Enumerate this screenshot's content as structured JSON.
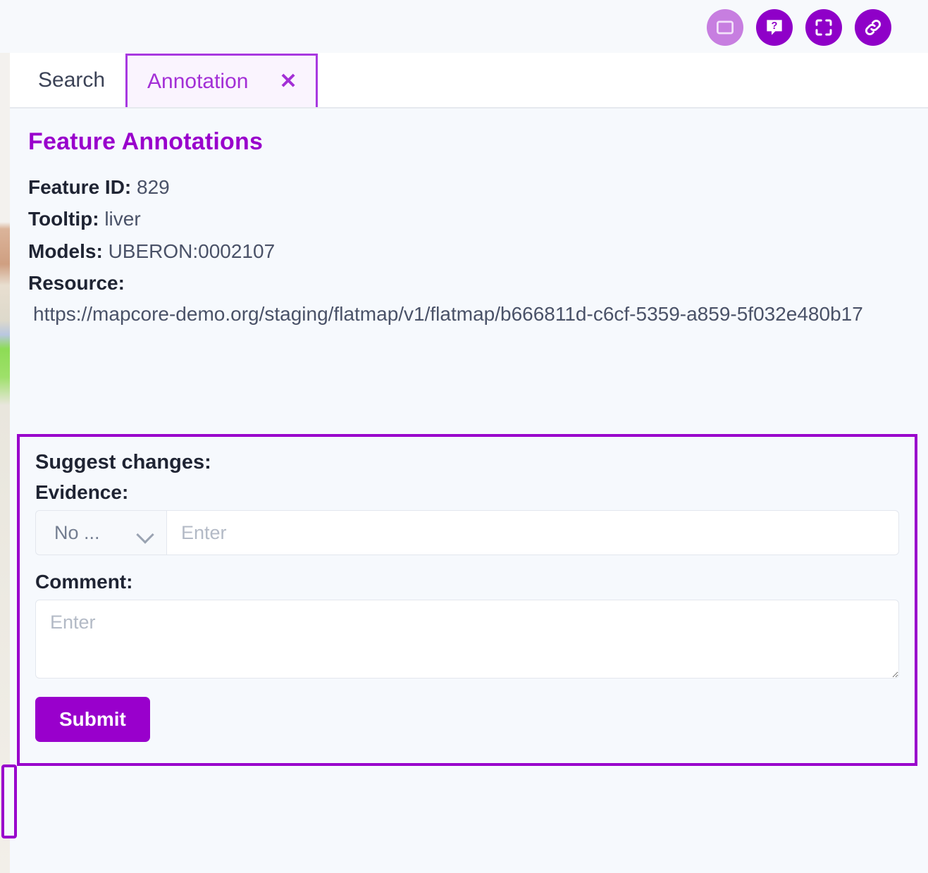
{
  "toolbar": {
    "icons": [
      {
        "name": "display-icon",
        "label": "Display",
        "style": "muted"
      },
      {
        "name": "help-icon",
        "label": "Help",
        "style": "solid"
      },
      {
        "name": "fullscreen-icon",
        "label": "Fullscreen",
        "style": "solid"
      },
      {
        "name": "link-icon",
        "label": "Copy link",
        "style": "solid"
      }
    ],
    "accent_color": "#8f00c8",
    "muted_color": "#c77ee0"
  },
  "tabs": [
    {
      "label": "Search",
      "active": false
    },
    {
      "label": "Annotation",
      "active": true,
      "close_label": "✕"
    }
  ],
  "annotations": {
    "title": "Feature Annotations",
    "feature_id_label": "Feature ID:",
    "feature_id_value": "829",
    "tooltip_label": "Tooltip:",
    "tooltip_value": "liver",
    "models_label": "Models:",
    "models_value": "UBERON:0002107",
    "resource_label": "Resource:",
    "resource_url": "https://mapcore-demo.org/staging/flatmap/v1/flatmap/b666811d-c6cf-5359-a859-5f032e480b17"
  },
  "suggest": {
    "heading": "Suggest changes:",
    "evidence_label": "Evidence:",
    "evidence_select_value": "No ...",
    "evidence_input_placeholder": "Enter",
    "evidence_input_value": "",
    "comment_label": "Comment:",
    "comment_placeholder": "Enter",
    "comment_value": "",
    "submit_label": "Submit",
    "border_color": "#9900cc"
  },
  "colors": {
    "accent": "#9900cc",
    "tab_active": "#a32fd6",
    "panel_bg": "#f6f9fd",
    "text": "#4a5268"
  }
}
